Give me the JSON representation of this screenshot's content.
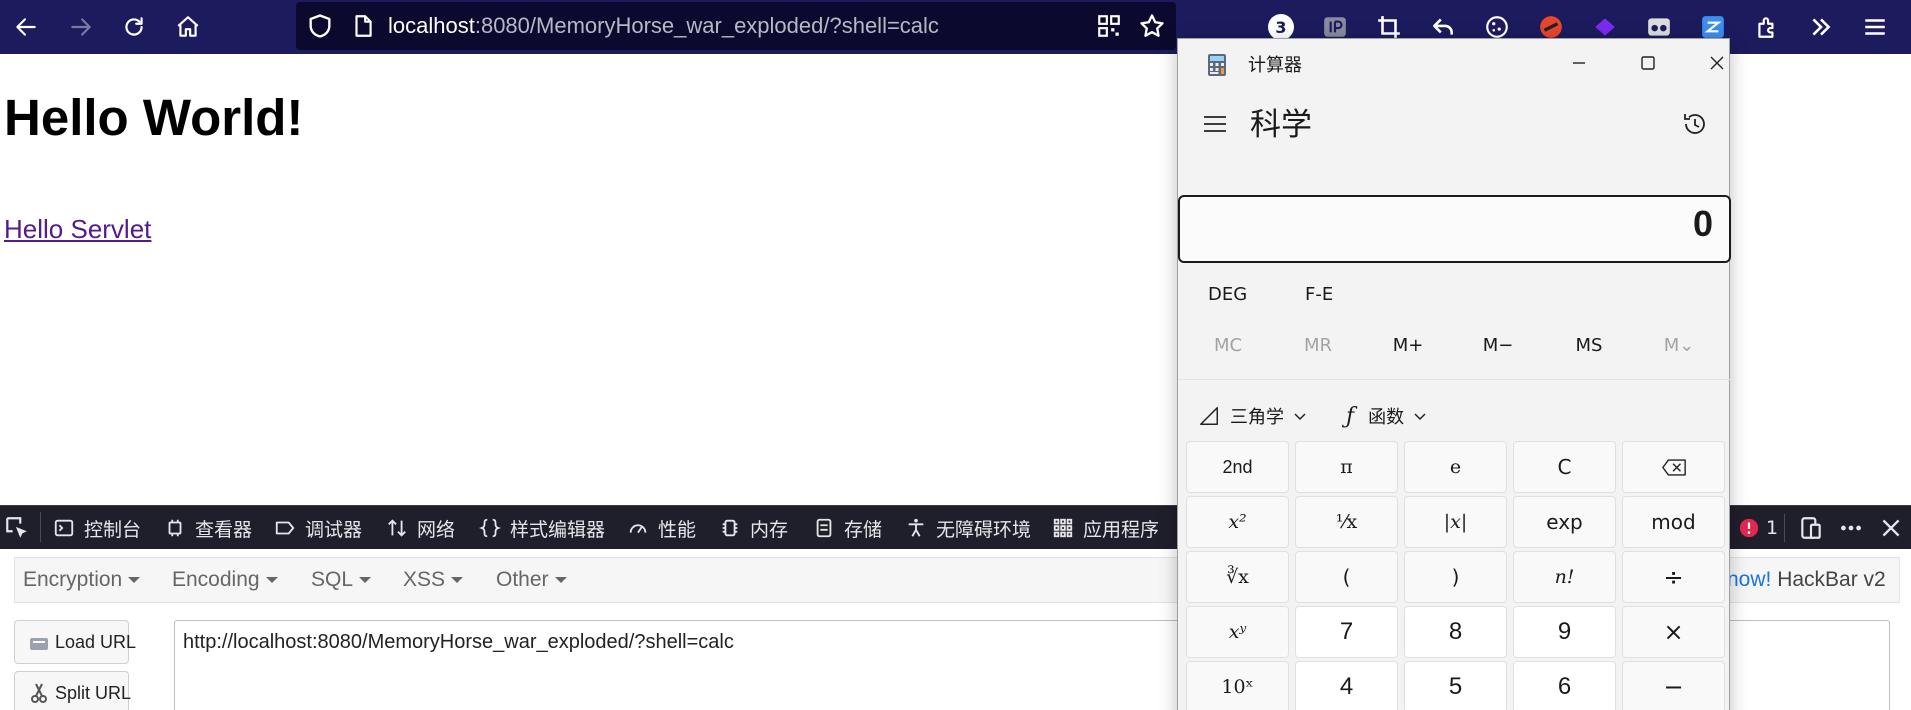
{
  "browser": {
    "url_host": "localhost",
    "url_rest": ":8080/MemoryHorse_war_exploded/?shell=calc",
    "extension_badge": "3",
    "icons": [
      "back-icon",
      "forward-icon",
      "reload-icon",
      "home-icon",
      "shield-icon",
      "page-icon",
      "qr-icon",
      "star-icon"
    ]
  },
  "page": {
    "heading": "Hello World!",
    "link": "Hello Servlet"
  },
  "devtools": {
    "tabs": [
      "控制台",
      "查看器",
      "调试器",
      "网络",
      "样式编辑器",
      "性能",
      "内存",
      "存储",
      "无障碍环境",
      "应用程序"
    ],
    "error_count": "1"
  },
  "hackbar": {
    "menus": [
      "Encryption",
      "Encoding",
      "SQL",
      "XSS",
      "Other"
    ],
    "promo_highlight": "now!",
    "promo_text": "HackBar v2",
    "load_url": "Load URL",
    "split_url": "Split URL",
    "url_value": "http://localhost:8080/MemoryHorse_war_exploded/?shell=calc"
  },
  "calculator": {
    "window_title": "计算器",
    "mode": "科学",
    "display": "0",
    "angle_mode": "DEG",
    "fe": "F-E",
    "memory": [
      {
        "label": "MC",
        "enabled": false
      },
      {
        "label": "MR",
        "enabled": false
      },
      {
        "label": "M+",
        "enabled": true
      },
      {
        "label": "M−",
        "enabled": true
      },
      {
        "label": "MS",
        "enabled": true
      },
      {
        "label": "M⌄",
        "enabled": false
      }
    ],
    "trig_label": "三角学",
    "func_label": "函数",
    "keys": {
      "r1": [
        "2nd",
        "π",
        "e",
        "C"
      ],
      "r2": [
        "x²",
        "¹⁄x",
        "|x|",
        "exp",
        "mod"
      ],
      "r3": [
        "∛x",
        "(",
        ")",
        "n!",
        "÷"
      ],
      "r4": [
        "xʸ",
        "7",
        "8",
        "9",
        "×"
      ],
      "r5": [
        "10ˣ",
        "4",
        "5",
        "6",
        "−"
      ]
    }
  }
}
